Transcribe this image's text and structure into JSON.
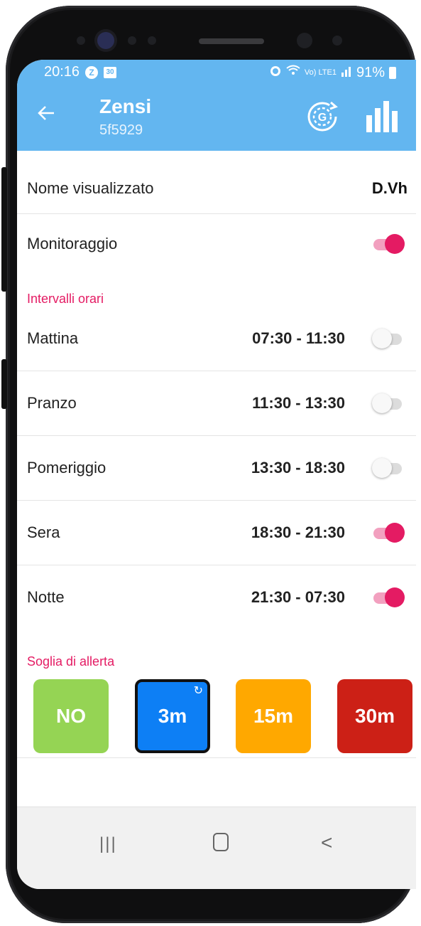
{
  "status_bar": {
    "time": "20:16",
    "badge_icon": "Z",
    "calendar_icon": "30",
    "network_label": "Vo) LTE1",
    "battery": "91%"
  },
  "app_bar": {
    "title": "Zensi",
    "subtitle": "5f5929",
    "back_icon": "arrow-left",
    "action_icons": [
      "refresh-gauge-icon",
      "bar-chart-icon"
    ]
  },
  "settings": {
    "display_name_label": "Nome visualizzato",
    "display_name_value": "D.Vh",
    "monitoring_label": "Monitoraggio",
    "monitoring_on": true
  },
  "intervals": {
    "section_title": "Intervalli orari",
    "items": [
      {
        "label": "Mattina",
        "time": "07:30 - 11:30",
        "on": false
      },
      {
        "label": "Pranzo",
        "time": "11:30 - 13:30",
        "on": false
      },
      {
        "label": "Pomeriggio",
        "time": "13:30 - 18:30",
        "on": false
      },
      {
        "label": "Sera",
        "time": "18:30 - 21:30",
        "on": true
      },
      {
        "label": "Notte",
        "time": "21:30 - 07:30",
        "on": true
      }
    ]
  },
  "alert_threshold": {
    "section_title": "Soglia di allerta",
    "options": [
      {
        "label": "NO",
        "color": "#95d454",
        "selected": false
      },
      {
        "label": "3m",
        "color": "#0d7ff5",
        "selected": true
      },
      {
        "label": "15m",
        "color": "#ffa800",
        "selected": false
      },
      {
        "label": "30m",
        "color": "#cc2016",
        "selected": false
      }
    ]
  },
  "colors": {
    "app_bar": "#63b6f0",
    "accent": "#e41b63"
  },
  "nav_bar": {
    "recent_glyph": "|||",
    "back_glyph": "<"
  }
}
